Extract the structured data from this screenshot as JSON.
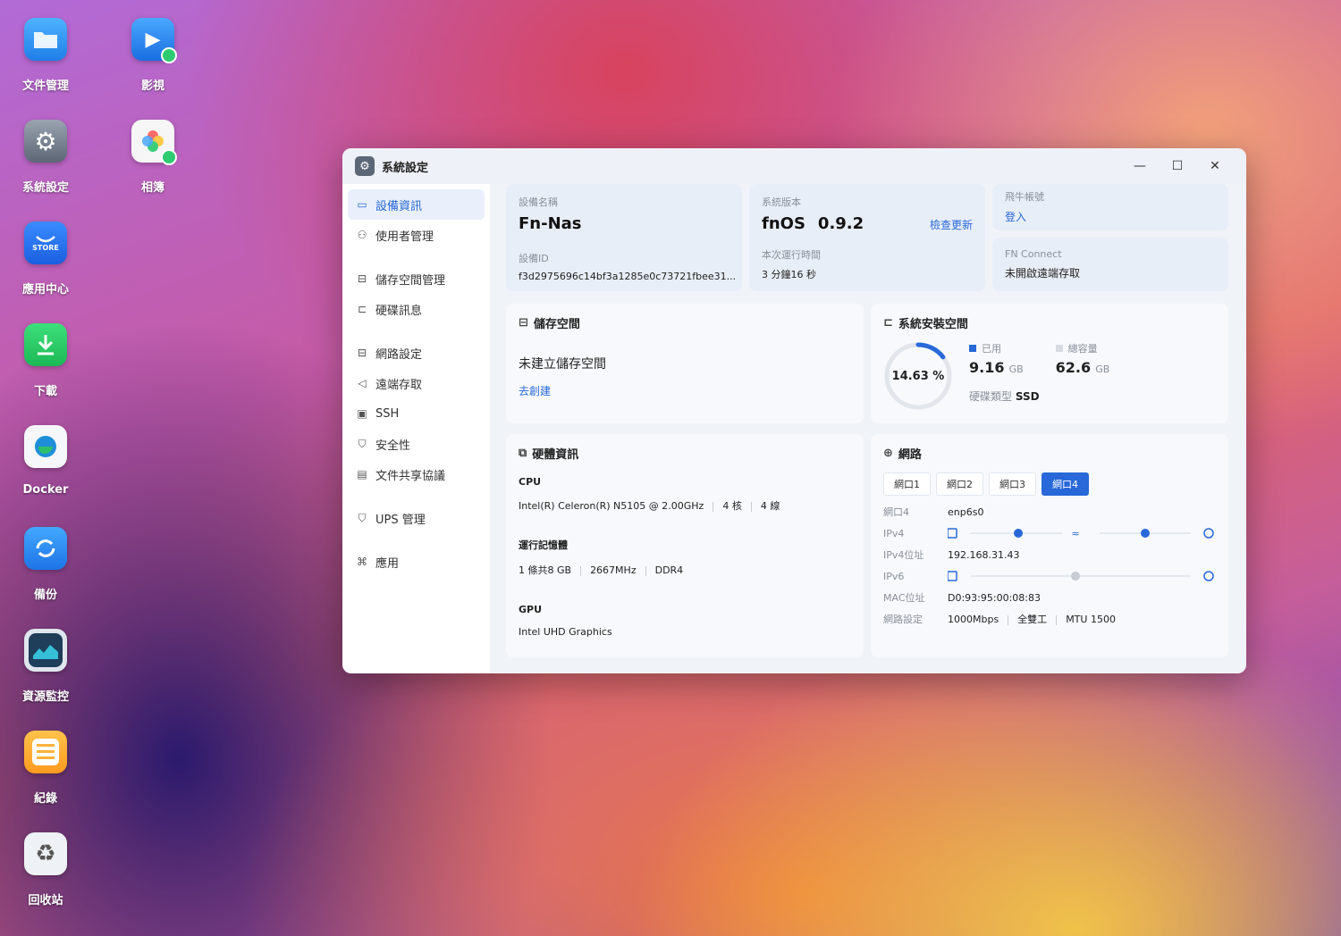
{
  "desktop": {
    "icons": [
      {
        "label": "文件管理"
      },
      {
        "label": "影視"
      },
      {
        "label": "系統設定"
      },
      {
        "label": "相簿"
      },
      {
        "label": "應用中心"
      },
      {
        "label": "下載"
      },
      {
        "label": "Docker"
      },
      {
        "label": "備份"
      },
      {
        "label": "資源監控"
      },
      {
        "label": "紀錄"
      },
      {
        "label": "回收站"
      }
    ],
    "store_text": "STORE"
  },
  "window": {
    "title": "系統設定",
    "controls": {
      "minimize": "—",
      "maximize": "☐",
      "close": "✕"
    }
  },
  "sidebar": {
    "items": [
      {
        "label": "設備資訊",
        "icon": "device-icon"
      },
      {
        "label": "使用者管理",
        "icon": "user-icon"
      },
      {
        "label": "儲存空間管理",
        "icon": "storage-icon"
      },
      {
        "label": "硬碟訊息",
        "icon": "disk-icon"
      },
      {
        "label": "網路設定",
        "icon": "network-icon"
      },
      {
        "label": "遠端存取",
        "icon": "remote-icon"
      },
      {
        "label": "SSH",
        "icon": "ssh-icon"
      },
      {
        "label": "安全性",
        "icon": "shield-icon"
      },
      {
        "label": "文件共享協議",
        "icon": "file-share-icon"
      },
      {
        "label": "UPS 管理",
        "icon": "ups-icon"
      },
      {
        "label": "應用",
        "icon": "apps-icon"
      }
    ]
  },
  "device": {
    "name_label": "設備名稱",
    "name": "Fn-Nas",
    "id_label": "設備ID",
    "id": "f3d2975696c14bf3a1285e0c73721fbee31..."
  },
  "version": {
    "label": "系統版本",
    "os": "fnOS",
    "number": "0.9.2",
    "check_update": "檢查更新",
    "uptime_label": "本次運行時間",
    "uptime": "3 分鐘16 秒"
  },
  "account": {
    "label": "飛牛帳號",
    "login": "登入",
    "connect_label": "FN Connect",
    "connect_status": "未開啟遠端存取"
  },
  "storage": {
    "title": "儲存空間",
    "empty": "未建立儲存空間",
    "create": "去創建"
  },
  "install_space": {
    "title": "系統安裝空間",
    "percent_text": "14.63 %",
    "percent": 14.63,
    "used_label": "已用",
    "used_value": "9.16",
    "used_unit": "GB",
    "total_label": "總容量",
    "total_value": "62.6",
    "total_unit": "GB",
    "disk_type_label": "硬碟類型",
    "disk_type": "SSD"
  },
  "hardware": {
    "title": "硬體資訊",
    "cpu_label": "CPU",
    "cpu_model": "Intel(R) Celeron(R) N5105 @ 2.00GHz",
    "cpu_cores": "4 核",
    "cpu_threads": "4 線",
    "mem_label": "運行記憶體",
    "mem_size": "1 條共8 GB",
    "mem_speed": "2667MHz",
    "mem_type": "DDR4",
    "gpu_label": "GPU",
    "gpu_model": "Intel UHD Graphics"
  },
  "network": {
    "title": "網路",
    "tabs": [
      "網口1",
      "網口2",
      "網口3",
      "網口4"
    ],
    "active_tab": 3,
    "port_label": "網口4",
    "port": "enp6s0",
    "ipv4_label": "IPv4",
    "ipv4_addr_label": "IPv4位址",
    "ipv4_addr": "192.168.31.43",
    "ipv6_label": "IPv6",
    "mac_label": "MAC位址",
    "mac": "D0:93:95:00:08:83",
    "settings_label": "網路設定",
    "speed": "1000Mbps",
    "duplex": "全雙工",
    "mtu": "MTU 1500"
  },
  "colors": {
    "accent": "#2868d8"
  }
}
